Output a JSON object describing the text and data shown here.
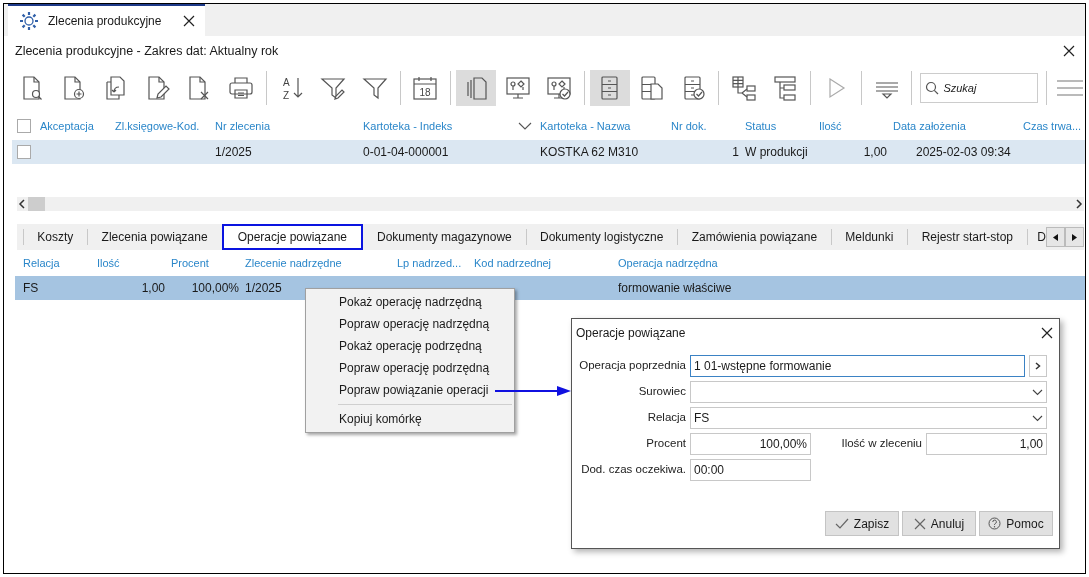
{
  "tab": {
    "title": "Zlecenia produkcyjne"
  },
  "header": {
    "title": "Zlecenia produkcyjne - Zakres dat: Aktualny rok"
  },
  "toolbar": {
    "groups": [
      [
        {
          "kind": "doc-search",
          "selected": false
        },
        {
          "kind": "doc-add",
          "selected": false
        },
        {
          "kind": "doc-copy",
          "selected": false
        },
        {
          "kind": "doc-edit",
          "selected": false
        },
        {
          "kind": "doc-delete",
          "selected": false
        },
        {
          "kind": "printer",
          "selected": false
        }
      ],
      [
        {
          "kind": "sort",
          "selected": false,
          "letters": [
            "A",
            "Z"
          ]
        },
        {
          "kind": "filter-edit",
          "selected": false
        },
        {
          "kind": "filter",
          "selected": false
        }
      ],
      [
        {
          "kind": "calendar",
          "selected": false,
          "text": "18"
        }
      ],
      [
        {
          "kind": "pages",
          "selected": true
        },
        {
          "kind": "monitor",
          "selected": false
        },
        {
          "kind": "monitor-check",
          "selected": false
        }
      ],
      [
        {
          "kind": "cabinet",
          "selected": true
        },
        {
          "kind": "cabinet-doc",
          "selected": false
        },
        {
          "kind": "cabinet-check",
          "selected": false
        }
      ],
      [
        {
          "kind": "hierarchy",
          "selected": false
        },
        {
          "kind": "tree",
          "selected": false
        }
      ],
      [
        {
          "kind": "play",
          "selected": false
        }
      ],
      [
        {
          "kind": "lines",
          "selected": false
        }
      ]
    ],
    "search": {
      "placeholder": "Szukaj"
    }
  },
  "main_table": {
    "header_checked": false,
    "columns": [
      "Akceptacja",
      "Zl.księgowe-Kod.",
      "Nr zlecenia",
      "Kartoteka - Indeks",
      "Kartoteka - Nazwa",
      "Nr dok.",
      "Status",
      "Ilość",
      "Data założenia",
      "Czas trwa..."
    ],
    "rows": [
      {
        "checked": false,
        "selected": true,
        "cells": [
          "",
          "",
          "1/2025",
          "0-01-04-000001",
          "KOSTKA 62 M310",
          "1",
          "W produkcji",
          "1,00",
          "2025-02-03 09:34",
          ""
        ]
      }
    ]
  },
  "detail_tabs": [
    {
      "label": "Koszty",
      "selected": false
    },
    {
      "label": "Zlecenia powiązane",
      "selected": false
    },
    {
      "label": "Operacje powiązane",
      "selected": true
    },
    {
      "label": "Dokumenty magazynowe",
      "selected": false
    },
    {
      "label": "Dokumenty logistyczne",
      "selected": false
    },
    {
      "label": "Zamówienia powiązane",
      "selected": false
    },
    {
      "label": "Meldunki",
      "selected": false
    },
    {
      "label": "Rejestr start-stop",
      "selected": false
    },
    {
      "label": "D",
      "selected": false
    }
  ],
  "detail_table": {
    "columns": [
      "Relacja",
      "Ilość",
      "Procent",
      "Zlecenie nadrzędne",
      "Lp nadrzed...",
      "Kod nadrzednej",
      "Operacja nadrzędna"
    ],
    "rows": [
      {
        "selected": true,
        "cells": [
          "FS",
          "1,00",
          "100,00%",
          "1/2025",
          "",
          "",
          "formowanie właściwe"
        ]
      }
    ]
  },
  "context_menu": {
    "groups": [
      [
        "Pokaż operację nadrzędną",
        "Popraw operację nadrzędną",
        "Pokaż operację podrzędną",
        "Popraw operację podrzędną",
        "Popraw powiązanie operacji"
      ],
      [
        "Kopiuj komórkę"
      ]
    ]
  },
  "dialog": {
    "title": "Operacje powiązane",
    "rows": [
      [
        {
          "label": "Operacja poprzednia",
          "value": "1 01-wstępne formowanie",
          "kind": "lookup",
          "focused": true
        }
      ],
      [
        {
          "label": "Surowiec",
          "kind": "combo",
          "focused": false
        }
      ],
      [
        {
          "label": "Relacja",
          "value": "FS",
          "kind": "combo",
          "focused": false
        }
      ],
      [
        {
          "label": "Procent",
          "value": "100,00%",
          "kind": "number",
          "focused": false
        },
        {
          "label": "Ilość w zleceniu",
          "value": "1,00",
          "kind": "number",
          "focused": false
        }
      ],
      [
        {
          "label": "Dod. czas oczekiwa.",
          "value": "00:00",
          "kind": "text",
          "focused": false
        }
      ]
    ],
    "buttons": [
      {
        "label": "Zapisz",
        "kind": "save"
      },
      {
        "label": "Anuluj",
        "kind": "cancel"
      },
      {
        "label": "Pomoc",
        "kind": "help"
      }
    ]
  }
}
